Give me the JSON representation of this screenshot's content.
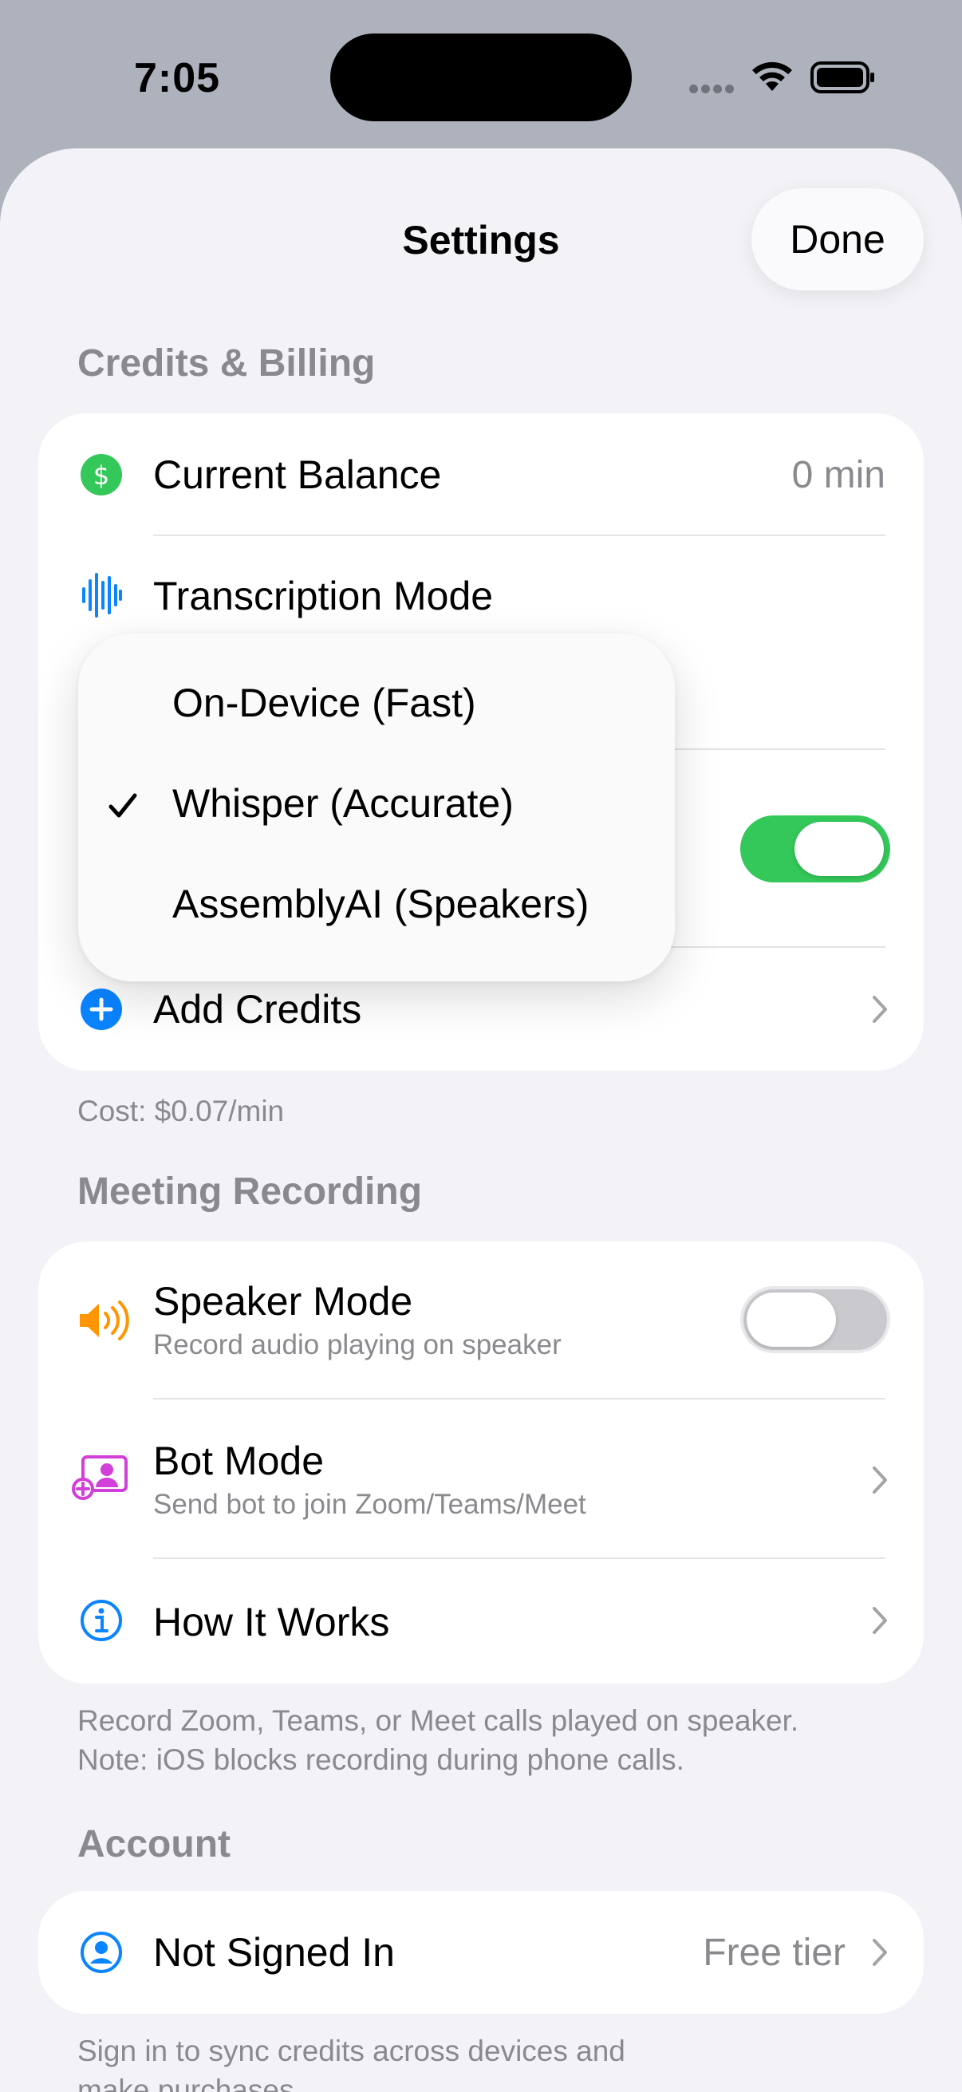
{
  "status_bar": {
    "time": "7:05"
  },
  "header": {
    "title": "Settings",
    "done_label": "Done"
  },
  "credits": {
    "section_title": "Credits & Billing",
    "balance_label": "Current Balance",
    "balance_value": "0 min",
    "mode_label": "Transcription Mode",
    "add_credits_label": "Add Credits",
    "footnote": "Cost: $0.07/min",
    "hidden_toggle_on": true
  },
  "transcription_menu": {
    "options": [
      "On-Device (Fast)",
      "Whisper (Accurate)",
      "AssemblyAI (Speakers)"
    ],
    "selected": "Whisper (Accurate)"
  },
  "meeting": {
    "section_title": "Meeting Recording",
    "speaker_label": "Speaker Mode",
    "speaker_sub": "Record audio playing on speaker",
    "speaker_on": false,
    "bot_label": "Bot Mode",
    "bot_sub": "Send bot to join Zoom/Teams/Meet",
    "how_label": "How It Works",
    "footnote_line1": "Record Zoom, Teams, or Meet calls played on speaker.",
    "footnote_line2": "Note: iOS blocks recording during phone calls."
  },
  "account": {
    "section_title": "Account",
    "label": "Not Signed In",
    "value": "Free tier",
    "footnote_line1": "Sign in to sync credits across devices and",
    "footnote_line2": "make purchases."
  },
  "colors": {
    "green": "#34c759",
    "blue": "#0a84ff",
    "orange": "#ff9500",
    "magenta": "#d33fd9",
    "secondary_text": "#8a8a8e",
    "background": "#f2f2f7"
  }
}
